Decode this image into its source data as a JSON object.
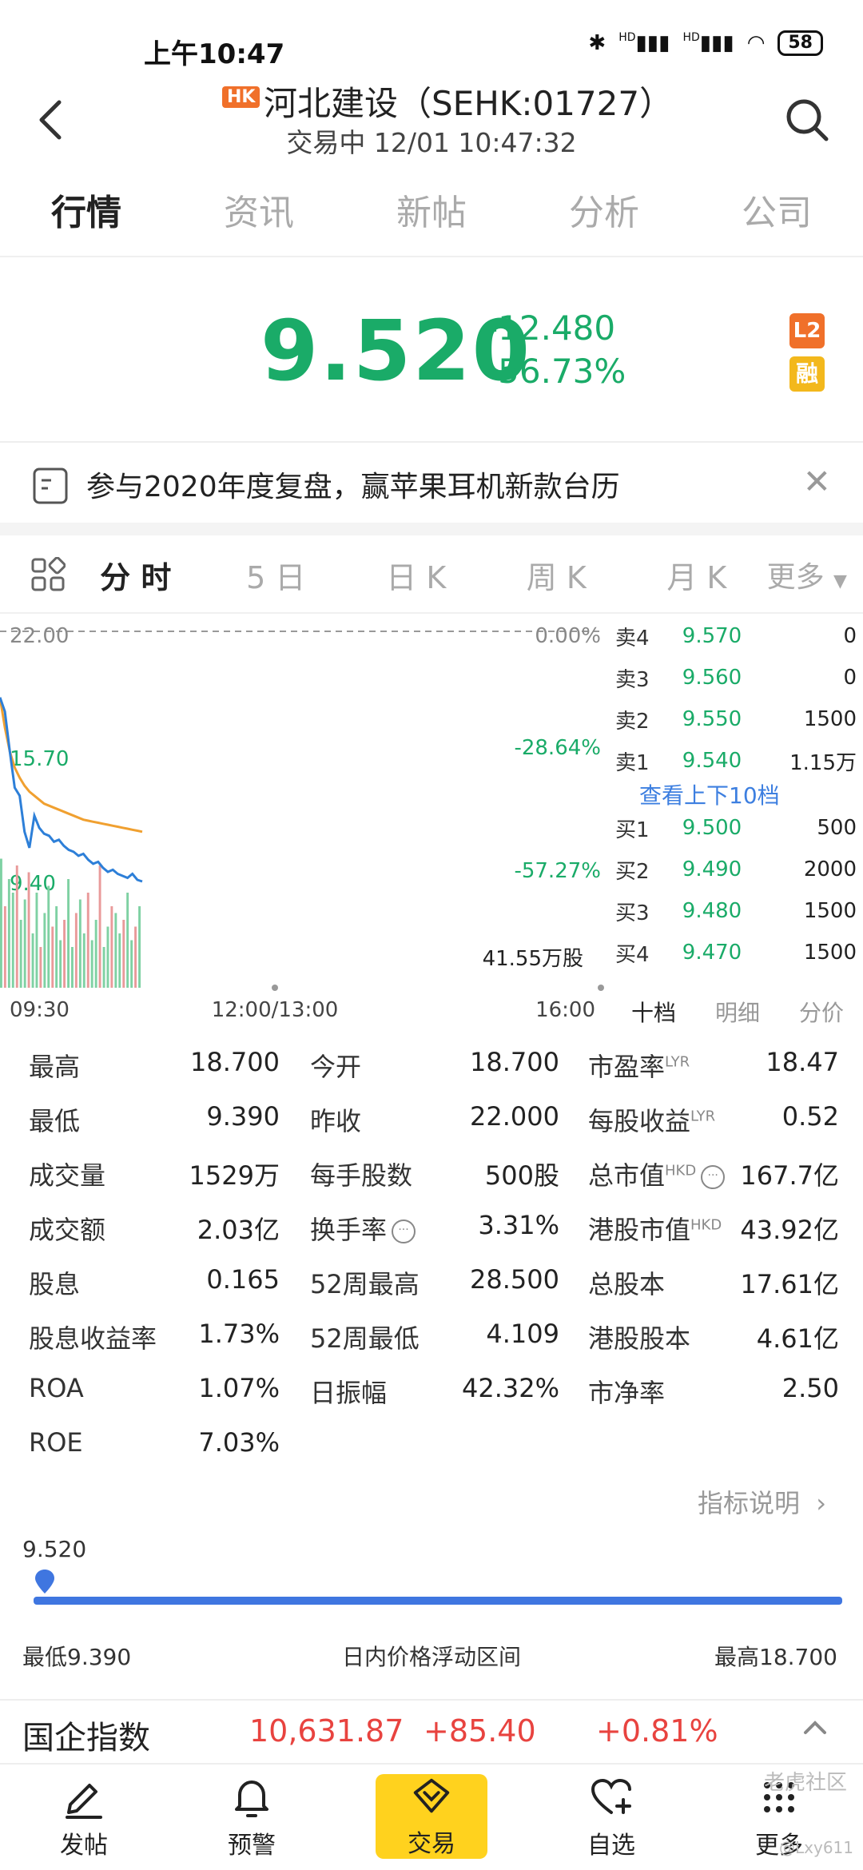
{
  "status_bar": {
    "time": "上午10:47",
    "battery": "58",
    "signal_label": "HD"
  },
  "header": {
    "market_badge": "HK",
    "title": "河北建设（SEHK:01727）",
    "status": "交易中 12/01 10:47:32"
  },
  "tabs": [
    "行情",
    "资讯",
    "新帖",
    "分析",
    "公司"
  ],
  "quote": {
    "price": "9.520",
    "change": "-12.480",
    "change_pct": "-56.73%",
    "badge_l2": "L2",
    "badge_margin": "融"
  },
  "banner": {
    "text": "参与2020年度复盘，赢苹果耳机新款台历"
  },
  "chart_tabs": [
    "分 时",
    "5 日",
    "日 K",
    "周 K",
    "月 K"
  ],
  "chart_tabs_more": "更多",
  "chart_data": {
    "type": "line",
    "y_left_labels": [
      "22.00",
      "15.70",
      "9.40"
    ],
    "y_right_labels": [
      "0.00%",
      "-28.64%",
      "-57.27%"
    ],
    "x_labels": [
      "09:30",
      "12:00/13:00",
      "16:00"
    ],
    "volume_label": "41.55万股",
    "ylim": [
      9.4,
      22.0
    ],
    "price_series": [
      18.7,
      18.0,
      16.0,
      14.2,
      13.8,
      12.0,
      11.2,
      12.8,
      12.2,
      11.9,
      11.8,
      11.5,
      11.6,
      11.3,
      11.1,
      11.0,
      10.8,
      10.9,
      10.6,
      10.4,
      10.5,
      10.2,
      10.0,
      10.1,
      9.9,
      9.8,
      9.7,
      9.9,
      9.6,
      9.52
    ],
    "avg_series": [
      18.7,
      17.2,
      16.0,
      15.2,
      14.7,
      14.3,
      14.0,
      13.8,
      13.6,
      13.4,
      13.3,
      13.2,
      13.1,
      13.0,
      12.9,
      12.8,
      12.7,
      12.6,
      12.55,
      12.5,
      12.45,
      12.4,
      12.35,
      12.3,
      12.25,
      12.2,
      12.15,
      12.1,
      12.05,
      12.0
    ],
    "volume_series": [
      0.95,
      0.6,
      0.8,
      0.7,
      0.9,
      0.5,
      0.65,
      0.85,
      0.4,
      0.7,
      0.3,
      0.55,
      0.75,
      0.45,
      0.6,
      0.35,
      0.5,
      0.8,
      0.3,
      0.55,
      0.65,
      0.4,
      0.7,
      0.35,
      0.5,
      0.9,
      0.3,
      0.45,
      0.6,
      0.55,
      0.4,
      0.5,
      0.7,
      0.35,
      0.45,
      0.6
    ]
  },
  "order_book": {
    "asks": [
      {
        "side": "卖4",
        "price": "9.570",
        "vol": "0"
      },
      {
        "side": "卖3",
        "price": "9.560",
        "vol": "0"
      },
      {
        "side": "卖2",
        "price": "9.550",
        "vol": "1500"
      },
      {
        "side": "卖1",
        "price": "9.540",
        "vol": "1.15万"
      }
    ],
    "link": "查看上下10档",
    "bids": [
      {
        "side": "买1",
        "price": "9.500",
        "vol": "500"
      },
      {
        "side": "买2",
        "price": "9.490",
        "vol": "2000"
      },
      {
        "side": "买3",
        "price": "9.480",
        "vol": "1500"
      },
      {
        "side": "买4",
        "price": "9.470",
        "vol": "1500"
      }
    ],
    "tabs": [
      "十档",
      "明细",
      "分价"
    ]
  },
  "stats": [
    [
      {
        "label": "最高",
        "value": "18.700"
      },
      {
        "label": "今开",
        "value": "18.700"
      },
      {
        "label": "市盈率",
        "sup": "LYR",
        "value": "18.47"
      }
    ],
    [
      {
        "label": "最低",
        "value": "9.390"
      },
      {
        "label": "昨收",
        "value": "22.000"
      },
      {
        "label": "每股收益",
        "sup": "LYR",
        "value": "0.52"
      }
    ],
    [
      {
        "label": "成交量",
        "value": "1529万"
      },
      {
        "label": "每手股数",
        "value": "500股"
      },
      {
        "label": "总市值",
        "sup": "HKD",
        "value": "167.7亿"
      }
    ],
    [
      {
        "label": "成交额",
        "value": "2.03亿"
      },
      {
        "label": "换手率",
        "value": "3.31%"
      },
      {
        "label": "港股市值",
        "sup": "HKD",
        "value": "43.92亿"
      }
    ],
    [
      {
        "label": "股息",
        "value": "0.165"
      },
      {
        "label": "52周最高",
        "value": "28.500"
      },
      {
        "label": "总股本",
        "value": "17.61亿"
      }
    ],
    [
      {
        "label": "股息收益率",
        "value": "1.73%"
      },
      {
        "label": "52周最低",
        "value": "4.109"
      },
      {
        "label": "港股股本",
        "value": "4.61亿"
      }
    ],
    [
      {
        "label": "ROA",
        "value": "1.07%"
      },
      {
        "label": "日振幅",
        "value": "42.32%"
      },
      {
        "label": "市净率",
        "value": "2.50"
      }
    ],
    [
      {
        "label": "ROE",
        "value": "7.03%"
      }
    ]
  ],
  "indicator_link": "指标说明",
  "range": {
    "current": "9.520",
    "low": "最低9.390",
    "title": "日内价格浮动区间",
    "high": "最高18.700",
    "position": 0.014
  },
  "ticker": {
    "name": "国企指数",
    "value": "10,631.87",
    "change": "+85.40",
    "change_pct": "+0.81%"
  },
  "nav": [
    "发帖",
    "预警",
    "交易",
    "自选",
    "更多"
  ],
  "watermark": "老虎社区",
  "watermark_user": "@Lxy611",
  "colors": {
    "down": "#1aab68",
    "up": "#e8433f",
    "avg_line": "#f0a030",
    "price_line": "#2d7fd8",
    "accent": "#ffd21e"
  }
}
